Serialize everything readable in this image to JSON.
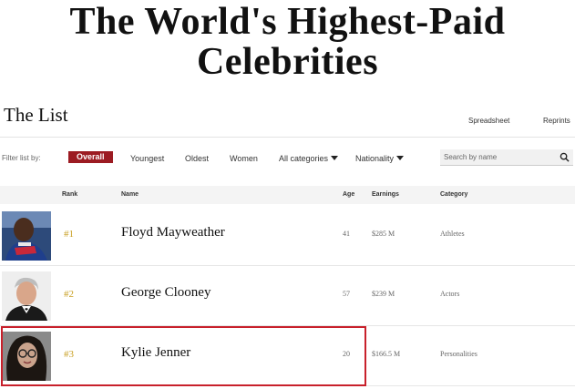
{
  "page": {
    "title_line1": "The World's Highest-Paid",
    "title_line2": "Celebrities"
  },
  "list": {
    "title": "The List",
    "links": {
      "spreadsheet": "Spreadsheet",
      "reprints": "Reprints"
    }
  },
  "filters": {
    "label": "Filter list by:",
    "overall": "Overall",
    "youngest": "Youngest",
    "oldest": "Oldest",
    "women": "Women",
    "all_categories": "All categories",
    "nationality": "Nationality",
    "active": "Overall",
    "search_placeholder": "Search by name"
  },
  "table": {
    "headers": {
      "rank": "Rank",
      "name": "Name",
      "age": "Age",
      "earnings": "Earnings",
      "category": "Category"
    },
    "rows": [
      {
        "rank": "#1",
        "name": "Floyd Mayweather",
        "age": "41",
        "earnings": "$285 M",
        "category": "Athletes"
      },
      {
        "rank": "#2",
        "name": "George Clooney",
        "age": "57",
        "earnings": "$239 M",
        "category": "Actors"
      },
      {
        "rank": "#3",
        "name": "Kylie Jenner",
        "age": "20",
        "earnings": "$166.5 M",
        "category": "Personalities"
      }
    ]
  },
  "colors": {
    "accent": "#9c1b22",
    "rank_gold": "#c9a024",
    "highlight_border": "#c8202b"
  },
  "highlight": {
    "row": "#3"
  }
}
